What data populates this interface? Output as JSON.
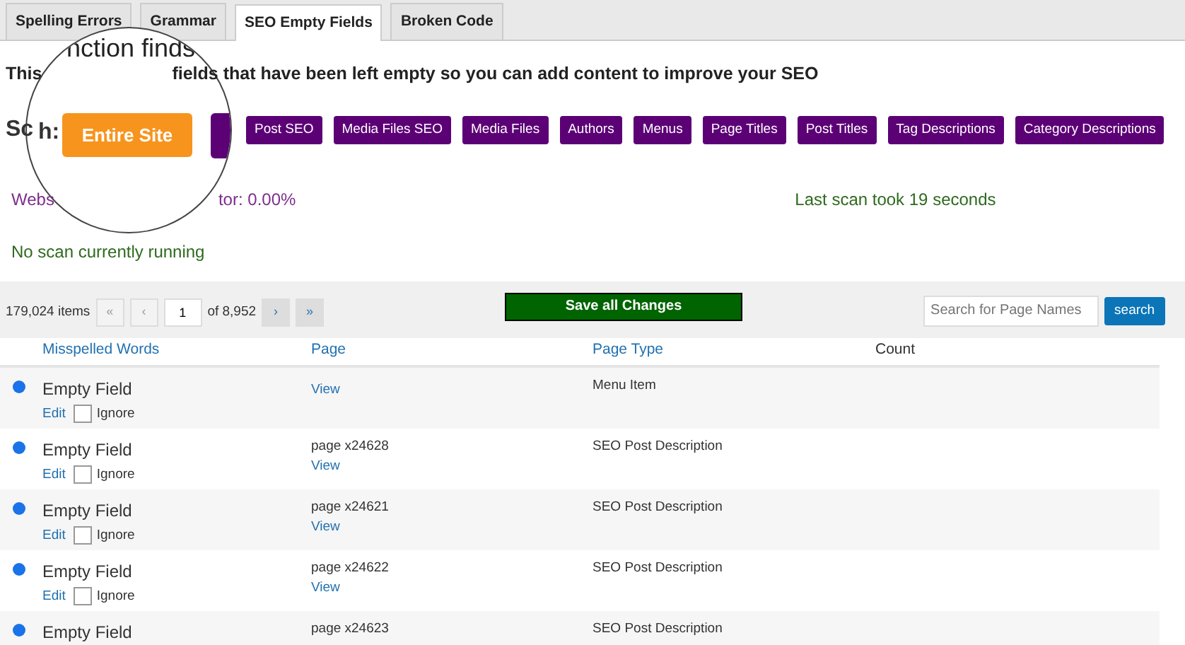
{
  "tabs": [
    {
      "label": "Spelling Errors",
      "selected": false
    },
    {
      "label": "Grammar",
      "selected": false
    },
    {
      "label": "SEO Empty Fields",
      "selected": true
    },
    {
      "label": "Broken Code",
      "selected": false
    }
  ],
  "description": {
    "before": "This",
    "after": "fields that have been left empty so you can add content to improve your SEO"
  },
  "scan_label": "Sc",
  "magnifier": {
    "text": "nction finds",
    "label": "h:",
    "button": "Entire Site"
  },
  "scan_buttons": [
    "Post SEO",
    "Media Files SEO",
    "Media Files",
    "Authors",
    "Menus",
    "Page Titles",
    "Post Titles",
    "Tag Descriptions",
    "Category Descriptions"
  ],
  "website_stat": {
    "before": "Webs",
    "after": "tor: 0.00%"
  },
  "last_scan": "Last scan took 19 seconds",
  "scan_status": "No scan currently running",
  "pagination": {
    "items": "179,024 items",
    "first": "«",
    "prev": "‹",
    "page": "1",
    "of": "of 8,952",
    "next": "›",
    "last": "»"
  },
  "save_button": "Save all Changes",
  "search": {
    "placeholder": "Search for Page Names",
    "button": "search"
  },
  "table": {
    "columns": [
      "Misspelled Words",
      "Page",
      "Page Type",
      "Count"
    ],
    "rows": [
      {
        "word": "Empty Field",
        "edit": "Edit",
        "ignore": "Ignore",
        "ignored": false,
        "page": "",
        "view": "View",
        "page_type": "Menu Item"
      },
      {
        "word": "Empty Field",
        "edit": "Edit",
        "ignore": "Ignore",
        "ignored": false,
        "page": "page x24628",
        "view": "View",
        "page_type": "SEO Post Description"
      },
      {
        "word": "Empty Field",
        "edit": "Edit",
        "ignore": "Ignore",
        "ignored": false,
        "page": "page x24621",
        "view": "View",
        "page_type": "SEO Post Description"
      },
      {
        "word": "Empty Field",
        "edit": "Edit",
        "ignore": "Ignore",
        "ignored": false,
        "page": "page x24622",
        "view": "View",
        "page_type": "SEO Post Description"
      },
      {
        "word": "Empty Field",
        "page": "page x24623",
        "page_type": "SEO Post Description"
      }
    ]
  }
}
